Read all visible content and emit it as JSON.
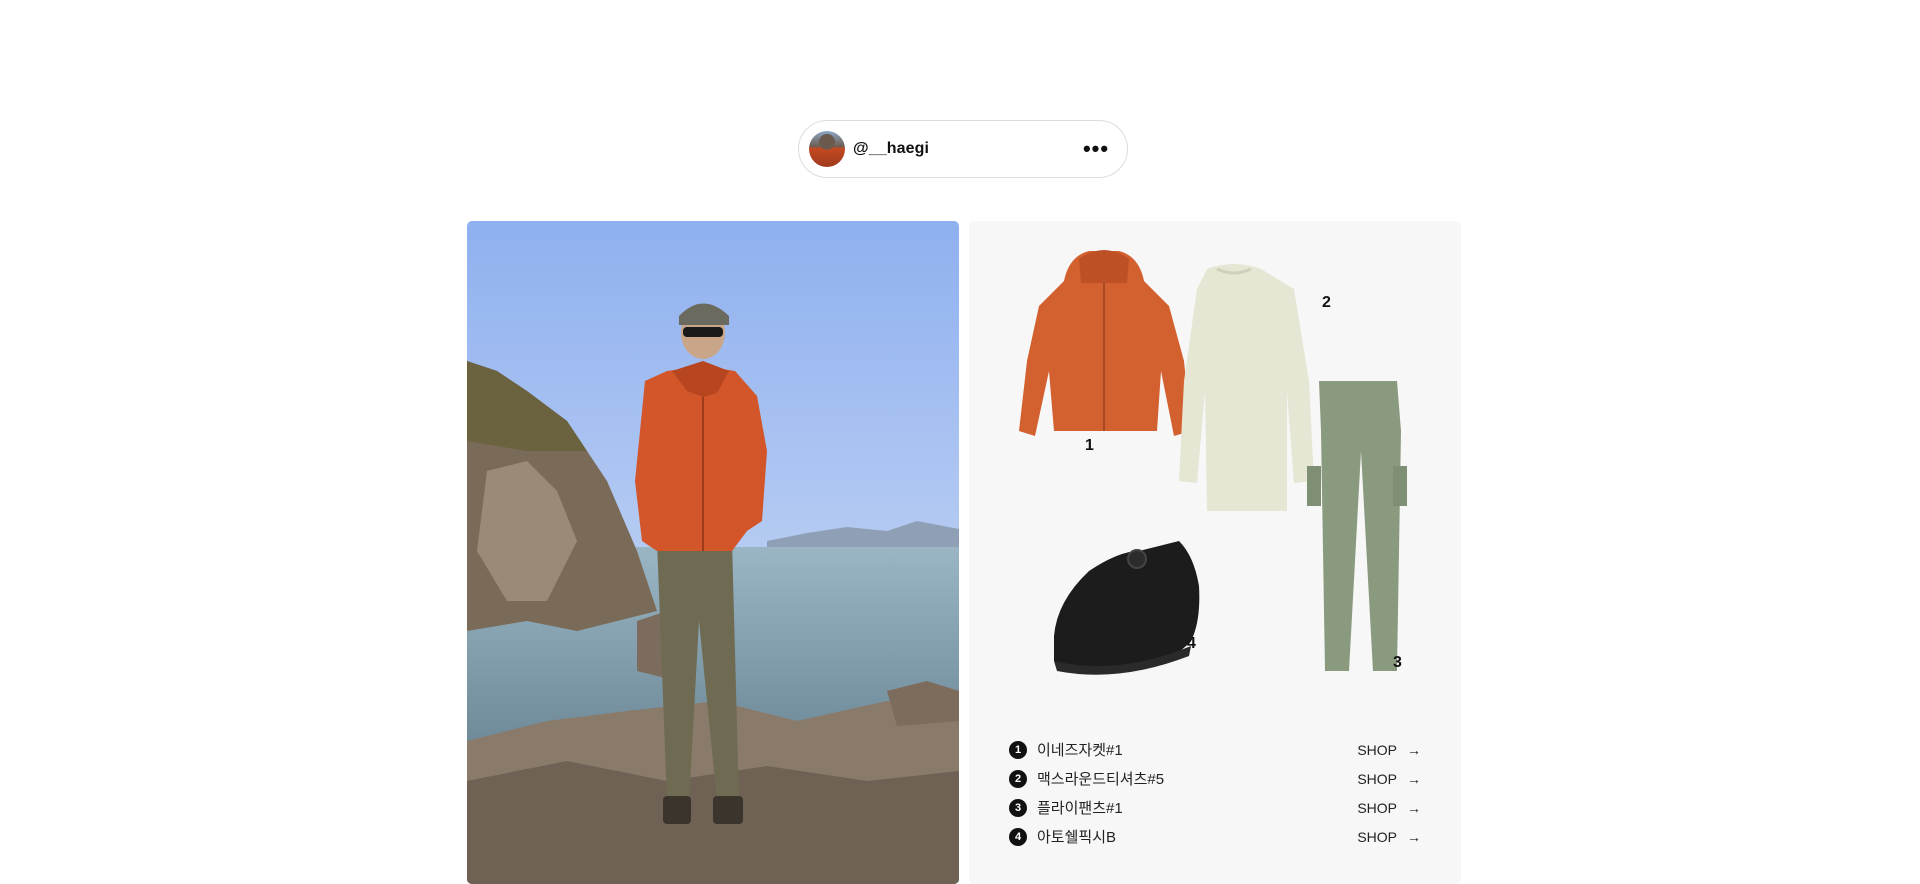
{
  "profile": {
    "username": "@__haegi",
    "more_icon": "•••"
  },
  "outfit": {
    "labels": [
      "1",
      "2",
      "3",
      "4"
    ],
    "products": [
      {
        "number": "1",
        "name": "이네즈자켓#1",
        "shop_label": "SHOP",
        "arrow": "→",
        "color": "#d3602f"
      },
      {
        "number": "2",
        "name": "맥스라운드티셔츠#5",
        "shop_label": "SHOP",
        "arrow": "→",
        "color": "#e5e6d4"
      },
      {
        "number": "3",
        "name": "플라이팬츠#1",
        "shop_label": "SHOP",
        "arrow": "→",
        "color": "#8a9a7e"
      },
      {
        "number": "4",
        "name": "아토쉘픽시B",
        "shop_label": "SHOP",
        "arrow": "→",
        "color": "#1c1c1c"
      }
    ]
  },
  "icons": {
    "more": "more-horizontal-icon",
    "shop_arrow": "arrow-right-icon"
  }
}
